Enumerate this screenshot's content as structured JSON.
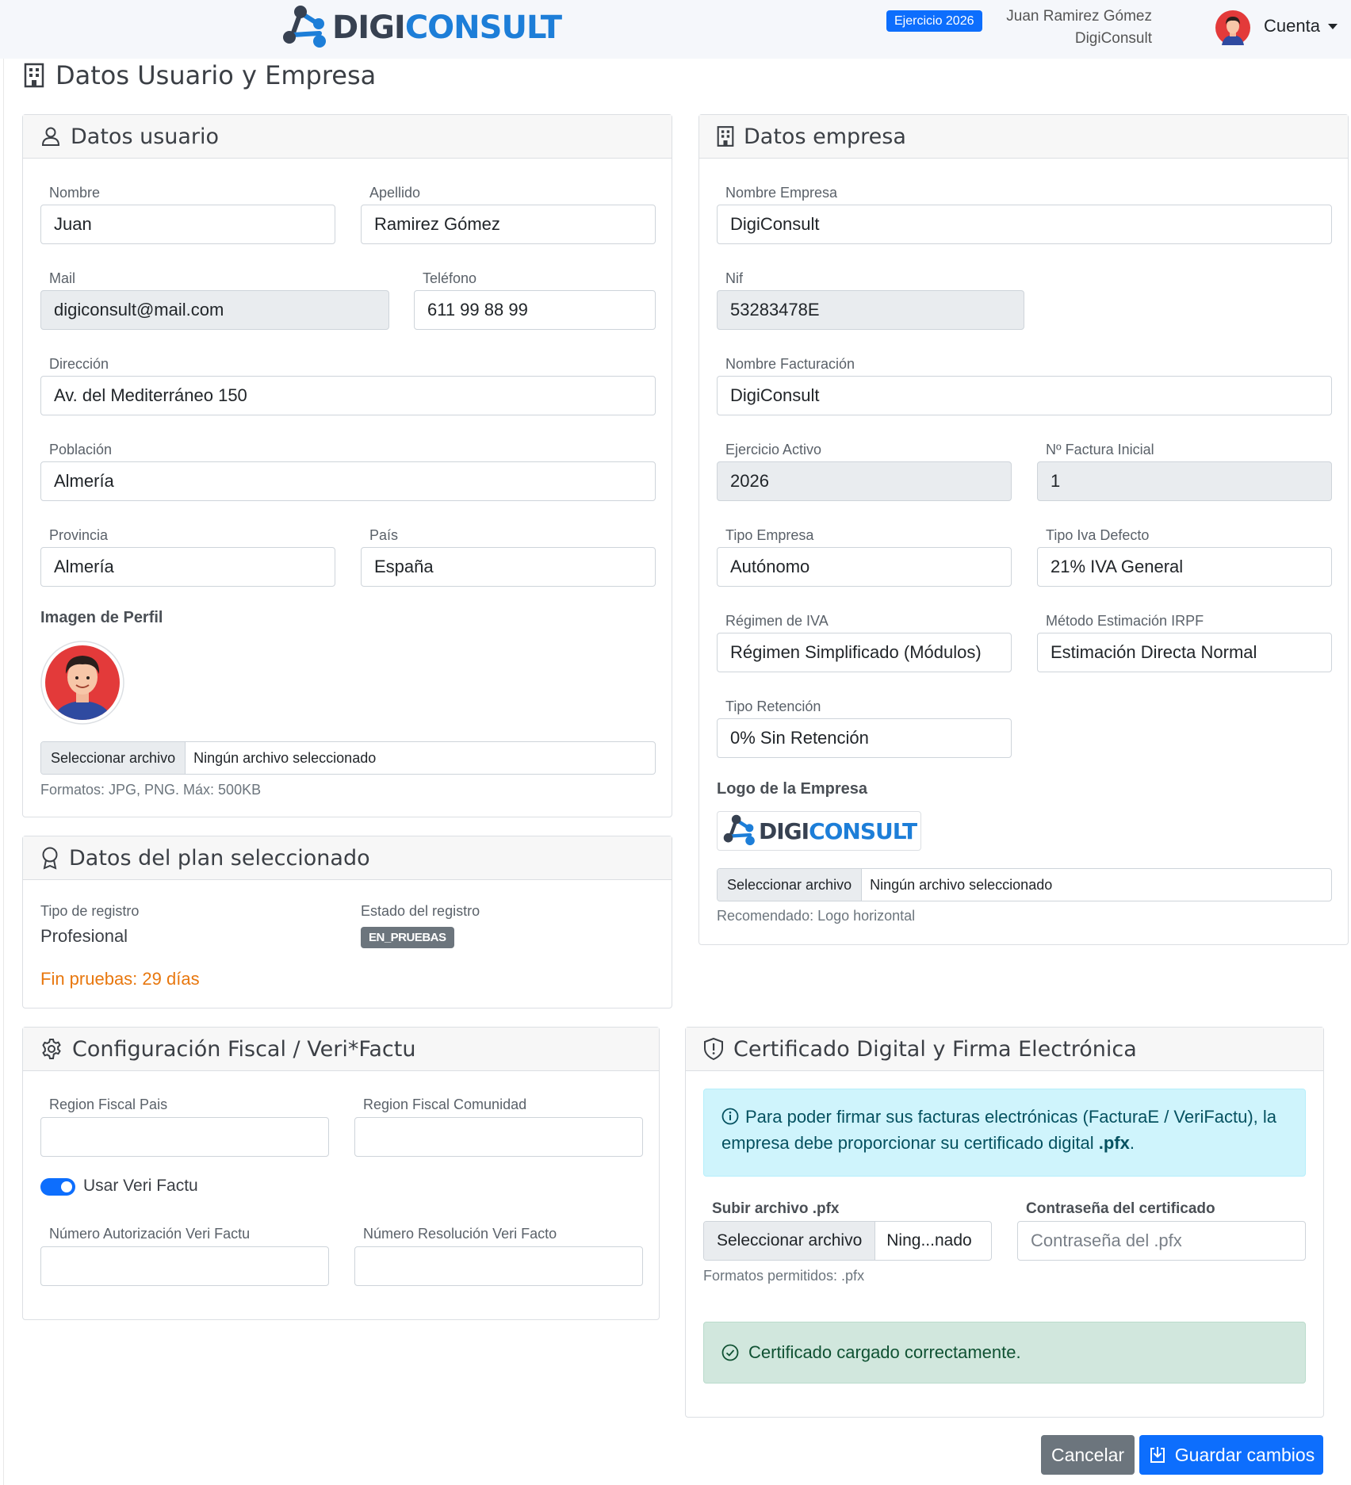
{
  "header": {
    "logo_digi": "DIGI",
    "logo_consult": "CONSULT",
    "ejercicio_badge": "Ejercicio 2026",
    "user_name": "Juan Ramirez Gómez",
    "user_company": "DigiConsult",
    "account_label": "Cuenta"
  },
  "page": {
    "title": "Datos Usuario y Empresa"
  },
  "usuario": {
    "title": "Datos usuario",
    "nombre_label": "Nombre",
    "nombre": "Juan",
    "apellido_label": "Apellido",
    "apellido": "Ramirez Gómez",
    "mail_label": "Mail",
    "mail": "digiconsult@mail.com",
    "telefono_label": "Teléfono",
    "telefono": "611 99 88 99",
    "direccion_label": "Dirección",
    "direccion": "Av. del Mediterráneo 150",
    "poblacion_label": "Población",
    "poblacion": "Almería",
    "provincia_label": "Provincia",
    "provincia": "Almería",
    "pais_label": "País",
    "pais": "España",
    "imagen_label": "Imagen de Perfil",
    "file_button": "Seleccionar archivo",
    "file_text": "Ningún archivo seleccionado",
    "formats_help": "Formatos: JPG, PNG. Máx: 500KB"
  },
  "plan": {
    "title": "Datos del plan seleccionado",
    "tipo_label": "Tipo de registro",
    "tipo": "Profesional",
    "estado_label": "Estado del registro",
    "estado": "EN_PRUEBAS",
    "fin_pruebas": "Fin pruebas: 29 días"
  },
  "empresa": {
    "title": "Datos empresa",
    "nombre_label": "Nombre Empresa",
    "nombre": "DigiConsult",
    "nif_label": "Nif",
    "nif": "53283478E",
    "facturacion_label": "Nombre Facturación",
    "facturacion": "DigiConsult",
    "ejercicio_label": "Ejercicio Activo",
    "ejercicio": "2026",
    "factura_label": "Nº Factura Inicial",
    "factura": "1",
    "tipo_empresa_label": "Tipo Empresa",
    "tipo_empresa": "Autónomo",
    "iva_label": "Tipo Iva Defecto",
    "iva": "21% IVA General",
    "regimen_label": "Régimen de IVA",
    "regimen": "Régimen Simplificado (Módulos)",
    "irpf_label": "Método Estimación IRPF",
    "irpf": "Estimación Directa Normal",
    "retencion_label": "Tipo Retención",
    "retencion": "0% Sin Retención",
    "logo_label": "Logo de la Empresa",
    "file_button": "Seleccionar archivo",
    "file_text": "Ningún archivo seleccionado",
    "logo_help": "Recomendado: Logo horizontal"
  },
  "fiscal": {
    "title": "Configuración Fiscal / Veri*Factu",
    "pais_label": "Region Fiscal Pais",
    "pais": "",
    "comunidad_label": "Region Fiscal Comunidad",
    "comunidad": "",
    "verifactu_label": "Usar Veri Factu",
    "autorizacion_label": "Número Autorización Veri Factu",
    "autorizacion": "",
    "resolucion_label": "Número Resolución Veri Facto",
    "resolucion": ""
  },
  "certificado": {
    "title": "Certificado Digital y Firma Electrónica",
    "info_text": "Para poder firmar sus facturas electrónicas (FacturaE / VeriFactu), la empresa debe proporcionar su certificado digital ",
    "info_bold": ".pfx",
    "info_end": ".",
    "upload_label": "Subir archivo .pfx",
    "file_button": "Seleccionar archivo",
    "file_text": "Ning...nado",
    "password_label": "Contraseña del certificado",
    "password_placeholder": "Contraseña del .pfx",
    "formats_help": "Formatos permitidos: .pfx",
    "success": "Certificado cargado correctamente."
  },
  "actions": {
    "cancel": "Cancelar",
    "save": "Guardar cambios"
  },
  "colors": {
    "primary": "#0d6efd",
    "secondary": "#6c757d",
    "warning_text": "#e8770e",
    "logo_blue": "#1d7ed8"
  }
}
